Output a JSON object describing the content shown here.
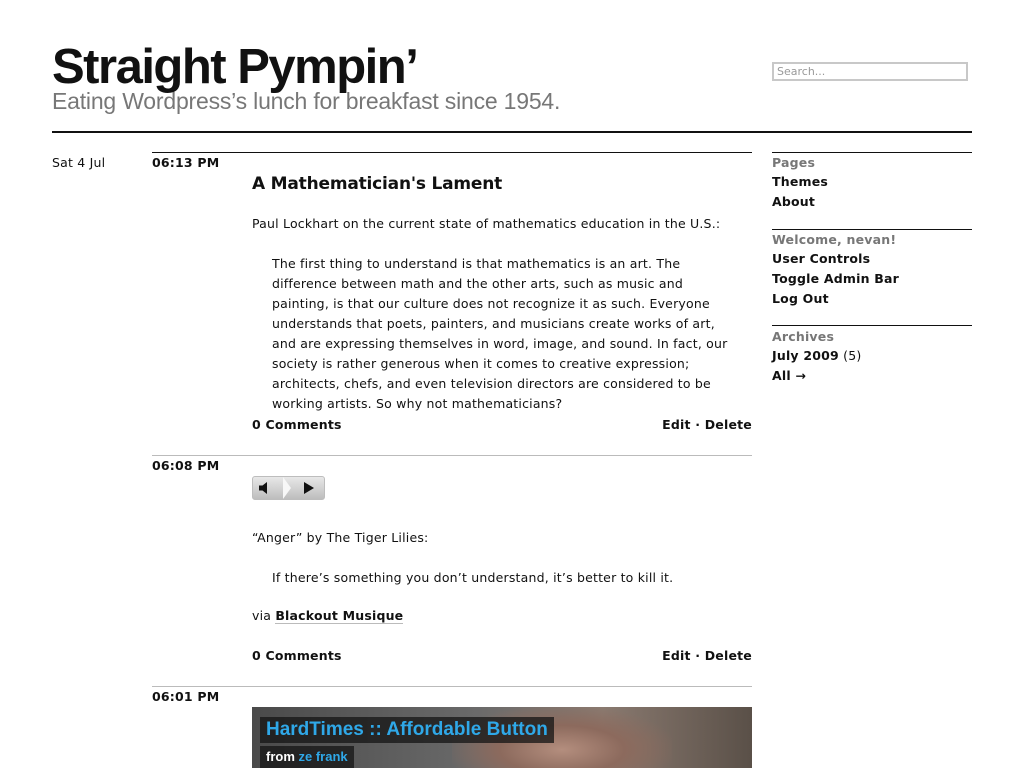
{
  "header": {
    "site_title": "Straight Pympin’",
    "tagline": "Eating Wordpress’s lunch for breakfast since 1954.",
    "search_placeholder": "Search..."
  },
  "day": {
    "date": "Sat 4 Jul"
  },
  "posts": [
    {
      "time": "06:13 PM",
      "title": "A Mathematician's Lament",
      "intro": "Paul Lockhart on the current state of mathematics education in the U.S.:",
      "quote": "The first thing to understand is that mathematics is an art. The difference between math and the other arts, such as music and painting, is that our culture does not recognize it as such. Everyone understands that poets, painters, and musicians create works of art, and are expressing themselves in word, image, and sound. In fact, our society is rather generous when it comes to creative expression; architects, chefs, and even television directors are considered to be working artists. So why not mathematicians?",
      "comments": "0 Comments",
      "edit": "Edit",
      "separator": "·",
      "delete": "Delete"
    },
    {
      "time": "06:08 PM",
      "intro": "“Anger” by The Tiger Lilies:",
      "quote": "If there’s something you don’t understand, it’s better to kill it.",
      "via_label": "via",
      "via_link": "Blackout Musique",
      "comments": "0 Comments",
      "edit": "Edit",
      "separator": "·",
      "delete": "Delete"
    },
    {
      "time": "06:01 PM",
      "video_title": "HardTimes :: Affordable Button",
      "video_from_label": "from",
      "video_from_name": "ze frank"
    }
  ],
  "sidebar": {
    "pages": {
      "heading": "Pages",
      "items": [
        "Themes",
        "About"
      ]
    },
    "welcome": {
      "heading": "Welcome, nevan!",
      "items": [
        "User Controls",
        "Toggle Admin Bar",
        "Log Out"
      ]
    },
    "archives": {
      "heading": "Archives",
      "month": "July 2009",
      "month_count": "(5)",
      "all": "All →"
    }
  },
  "colors": {
    "accent_blue": "#2fa8e8",
    "muted_gray": "#777777"
  },
  "icons": {
    "speaker": "speaker-icon",
    "play": "play-icon"
  }
}
